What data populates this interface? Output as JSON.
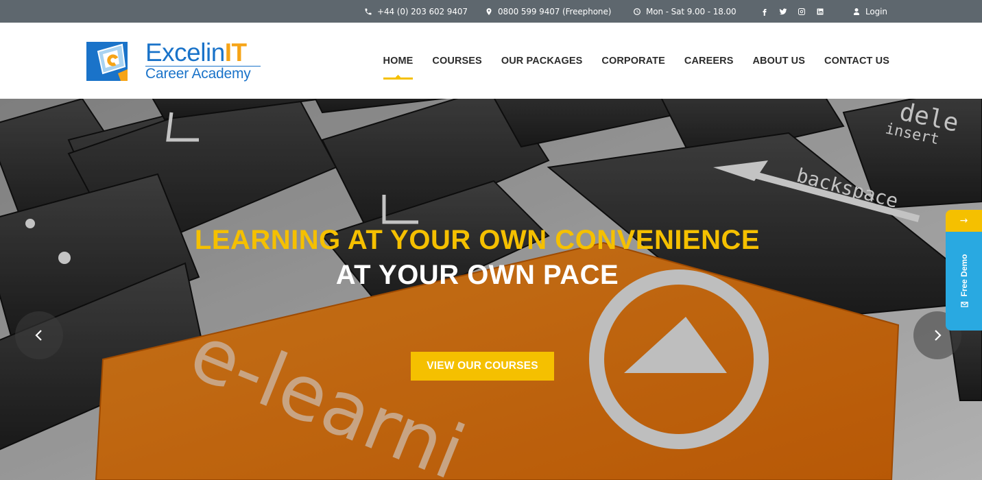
{
  "topbar": {
    "phone": "+44 (0) 203 602 9407",
    "freephone": "0800 599 9407 (Freephone)",
    "hours": "Mon - Sat 9.00 - 18.00",
    "login": "Login",
    "social": [
      "facebook-icon",
      "twitter-icon",
      "instagram-icon",
      "linkedin-icon"
    ]
  },
  "logo": {
    "brand_part1": "Excelin",
    "brand_part2": "IT",
    "tagline": "Career Academy"
  },
  "nav": {
    "items": [
      {
        "label": "HOME",
        "active": true
      },
      {
        "label": "COURSES",
        "active": false
      },
      {
        "label": "OUR PACKAGES",
        "active": false
      },
      {
        "label": "CORPORATE",
        "active": false
      },
      {
        "label": "CAREERS",
        "active": false
      },
      {
        "label": "ABOUT US",
        "active": false
      },
      {
        "label": "CONTACT US",
        "active": false
      }
    ]
  },
  "hero": {
    "title_line1": "LEARNING AT YOUR OWN CONVENIENCE",
    "title_line2": "AT YOUR OWN PACE",
    "cta": "VIEW OUR COURSES",
    "key_labels": {
      "backspace": "backspace",
      "insert": "insert",
      "delete": "dele",
      "elearning": "e-learni"
    }
  },
  "demo_tab": {
    "arrow": "→",
    "label": "Free Demo"
  },
  "colors": {
    "topbar_bg": "#5e676e",
    "accent_yellow": "#f5c000",
    "brand_blue": "#1a73c9",
    "brand_orange": "#f6a417",
    "demo_blue": "#29a9e1"
  }
}
